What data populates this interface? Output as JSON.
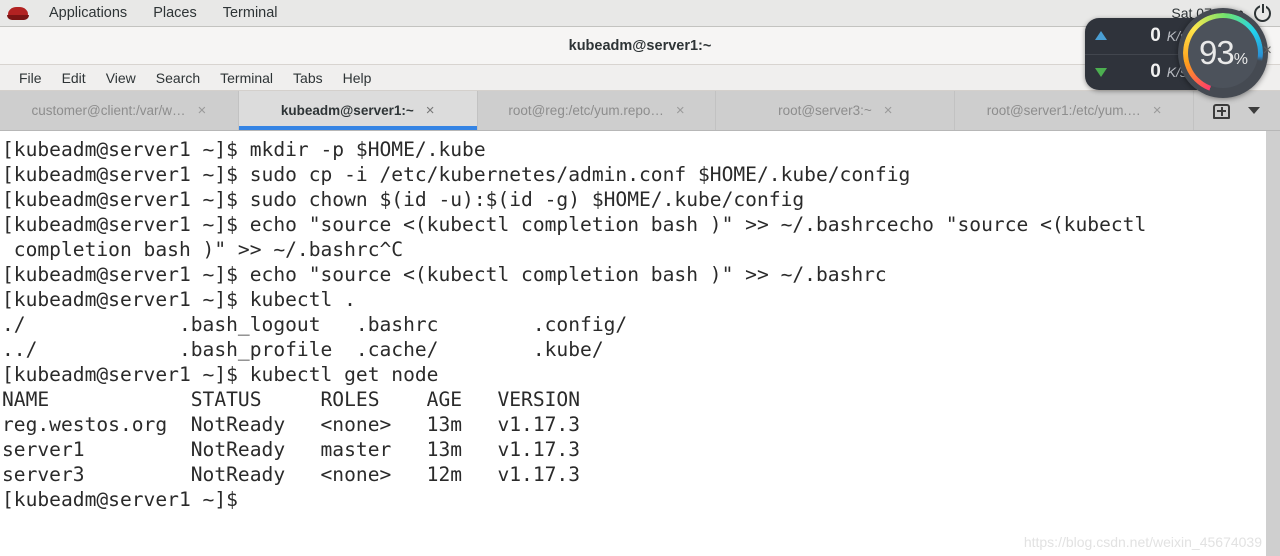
{
  "topbar": {
    "logo": "redhat-logo",
    "items": [
      "Applications",
      "Places",
      "Terminal"
    ],
    "clock": "Sat 07:09",
    "dot": "●",
    "power_icon": "power-icon"
  },
  "window": {
    "title": "kubeadm@server1:~"
  },
  "menubar": {
    "items": [
      "File",
      "Edit",
      "View",
      "Search",
      "Terminal",
      "Tabs",
      "Help"
    ]
  },
  "tabs": {
    "items": [
      {
        "label": "customer@client:/var/w…",
        "active": false,
        "close": "×"
      },
      {
        "label": "kubeadm@server1:~",
        "active": true,
        "close": "×"
      },
      {
        "label": "root@reg:/etc/yum.repo…",
        "active": false,
        "close": "×"
      },
      {
        "label": "root@server3:~",
        "active": false,
        "close": "×"
      },
      {
        "label": "root@server1:/etc/yum.…",
        "active": false,
        "close": "×"
      }
    ],
    "new_tab_icon": "new-tab-icon",
    "tab_menu_icon": "chevron-down-icon",
    "active_underline_color": "#3584e4"
  },
  "terminal": {
    "prompt": "[kubeadm@server1 ~]$ ",
    "lines": [
      "[kubeadm@server1 ~]$ mkdir -p $HOME/.kube",
      "[kubeadm@server1 ~]$ sudo cp -i /etc/kubernetes/admin.conf $HOME/.kube/config",
      "[kubeadm@server1 ~]$ sudo chown $(id -u):$(id -g) $HOME/.kube/config",
      "[kubeadm@server1 ~]$ echo \"source <(kubectl completion bash )\" >> ~/.bashrcecho \"source <(kubectl",
      " completion bash )\" >> ~/.bashrc^C",
      "[kubeadm@server1 ~]$ echo \"source <(kubectl completion bash )\" >> ~/.bashrc",
      "[kubeadm@server1 ~]$ kubectl .",
      "./             .bash_logout   .bashrc        .config/",
      "../            .bash_profile  .cache/        .kube/",
      "[kubeadm@server1 ~]$ kubectl get node",
      "NAME            STATUS     ROLES    AGE   VERSION",
      "reg.westos.org  NotReady   <none>   13m   v1.17.3",
      "server1         NotReady   master   13m   v1.17.3",
      "server3         NotReady   <none>   12m   v1.17.3",
      "[kubeadm@server1 ~]$ "
    ],
    "node_table": {
      "columns": [
        "NAME",
        "STATUS",
        "ROLES",
        "AGE",
        "VERSION"
      ],
      "rows": [
        [
          "reg.westos.org",
          "NotReady",
          "<none>",
          "13m",
          "v1.17.3"
        ],
        [
          "server1",
          "NotReady",
          "master",
          "13m",
          "v1.17.3"
        ],
        [
          "server3",
          "NotReady",
          "<none>",
          "12m",
          "v1.17.3"
        ]
      ]
    },
    "watermark": "https://blog.csdn.net/weixin_45674039",
    "background": "#ffffff",
    "foreground": "#2a2a2a"
  },
  "netmon": {
    "upload": {
      "value": "0",
      "unit": "K/s",
      "icon": "arrow-up-icon",
      "color": "#4a9fd4"
    },
    "download": {
      "value": "0",
      "unit": "K/s",
      "icon": "arrow-down-icon",
      "color": "#4caf50"
    }
  },
  "gauge": {
    "value": "93",
    "unit": "%",
    "close": "×"
  }
}
